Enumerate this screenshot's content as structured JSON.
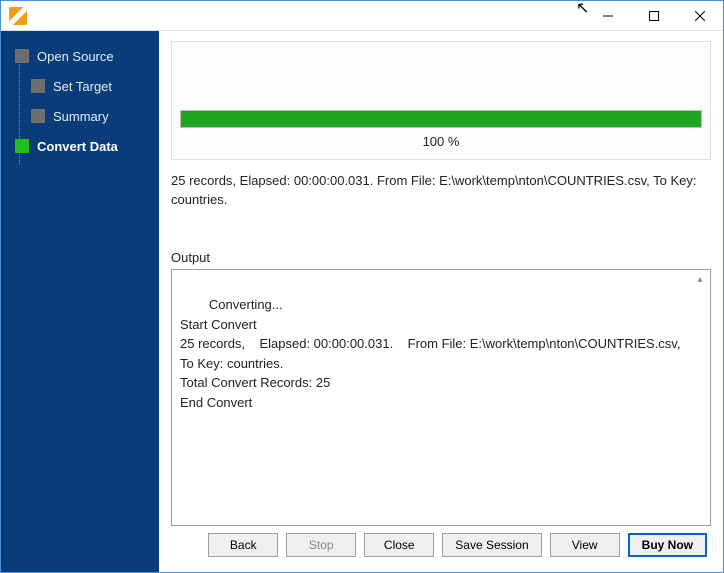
{
  "sidebar": {
    "items": [
      {
        "label": "Open Source"
      },
      {
        "label": "Set Target"
      },
      {
        "label": "Summary"
      },
      {
        "label": "Convert Data"
      }
    ]
  },
  "progress": {
    "percent_label": "100 %",
    "fill_width": "100%"
  },
  "summary_line": "25 records,    Elapsed: 00:00:00.031.    From File: E:\\work\\temp\\nton\\COUNTRIES.csv,    To Key: countries.",
  "output": {
    "label": "Output",
    "text": "Converting...\nStart Convert\n25 records,    Elapsed: 00:00:00.031.    From File: E:\\work\\temp\\nton\\COUNTRIES.csv,    To Key: countries.\nTotal Convert Records: 25\nEnd Convert"
  },
  "buttons": {
    "back": "Back",
    "stop": "Stop",
    "close": "Close",
    "save_session": "Save Session",
    "view": "View",
    "buy_now": "Buy Now"
  }
}
